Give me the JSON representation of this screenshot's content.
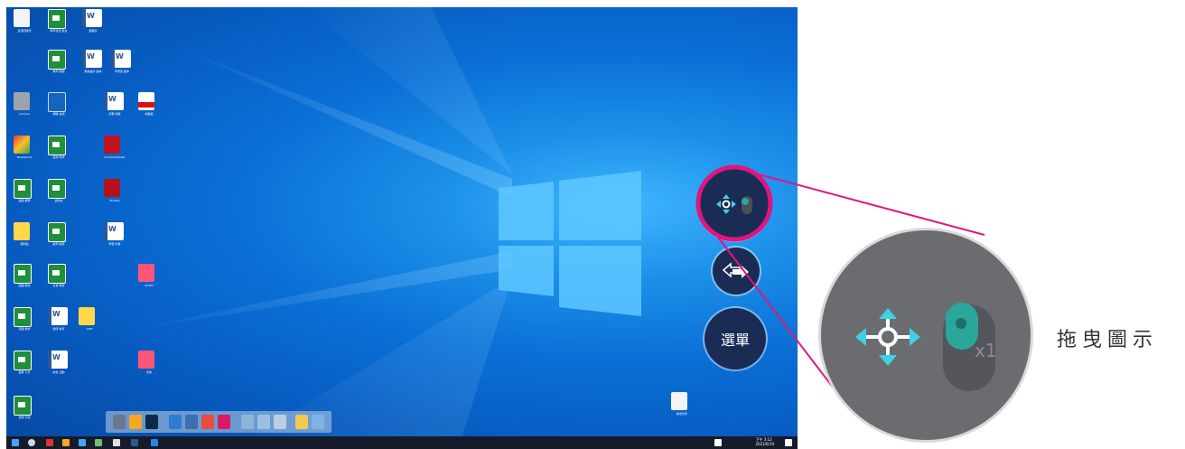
{
  "desktop": {
    "icons": [
      {
        "label": "資源回收筒",
        "type": "g-page"
      },
      {
        "label": "教學資源 整合",
        "type": "g-green"
      },
      {
        "label": "課程表",
        "type": "g-word"
      },
      {
        "label": "教學 簡報",
        "type": "g-green"
      },
      {
        "label": "教案設計 範本",
        "type": "g-word"
      },
      {
        "label": "學習單 範本",
        "type": "g-word"
      },
      {
        "label": "Chrome",
        "type": "g-grey"
      },
      {
        "label": "網路 電視",
        "type": "g-blue"
      },
      {
        "label": "評量 紀錄",
        "type": "g-word"
      },
      {
        "label": "成績單",
        "type": "g-pdf"
      },
      {
        "label": "BlueStacks",
        "type": "g-multi"
      },
      {
        "label": "自然 科學",
        "type": "g-green"
      },
      {
        "label": "Acrobat Reader",
        "type": "g-adobe"
      },
      {
        "label": "班級 經營",
        "type": "g-green"
      },
      {
        "label": "資料夾",
        "type": "g-green"
      },
      {
        "label": "McAfee",
        "type": "g-red"
      },
      {
        "label": "便利貼",
        "type": "g-yellow"
      },
      {
        "label": "數學 練習",
        "type": "g-green"
      },
      {
        "label": "學習 計畫",
        "type": "g-word"
      },
      {
        "label": "國語 教材",
        "type": "g-green"
      },
      {
        "label": "社會 教材",
        "type": "g-green"
      },
      {
        "label": "ZOOM",
        "type": "g-pink"
      },
      {
        "label": "英語 教材",
        "type": "g-green"
      },
      {
        "label": "健康 教育",
        "type": "g-word"
      },
      {
        "label": "LINE",
        "type": "g-yellow"
      },
      {
        "label": "藝術 人文",
        "type": "g-green"
      },
      {
        "label": "綜合 活動",
        "type": "g-word"
      },
      {
        "label": "表情",
        "type": "g-pink"
      },
      {
        "label": "校務 行政",
        "type": "g-green"
      },
      {
        "label": "新增文件",
        "type": "g-page"
      }
    ],
    "clock_time": "下午 3:12",
    "clock_date": "2021/6/19"
  },
  "floating_toolbar": {
    "drag_button_icon": "drag-move-icon",
    "switch_button_icon": "switch-arrows-icon",
    "menu_label": "選單"
  },
  "callout": {
    "caption": "拖曳圖示",
    "badge_text": "x1",
    "accent": "#e0157f",
    "arrow_color": "#3fd0e6"
  }
}
